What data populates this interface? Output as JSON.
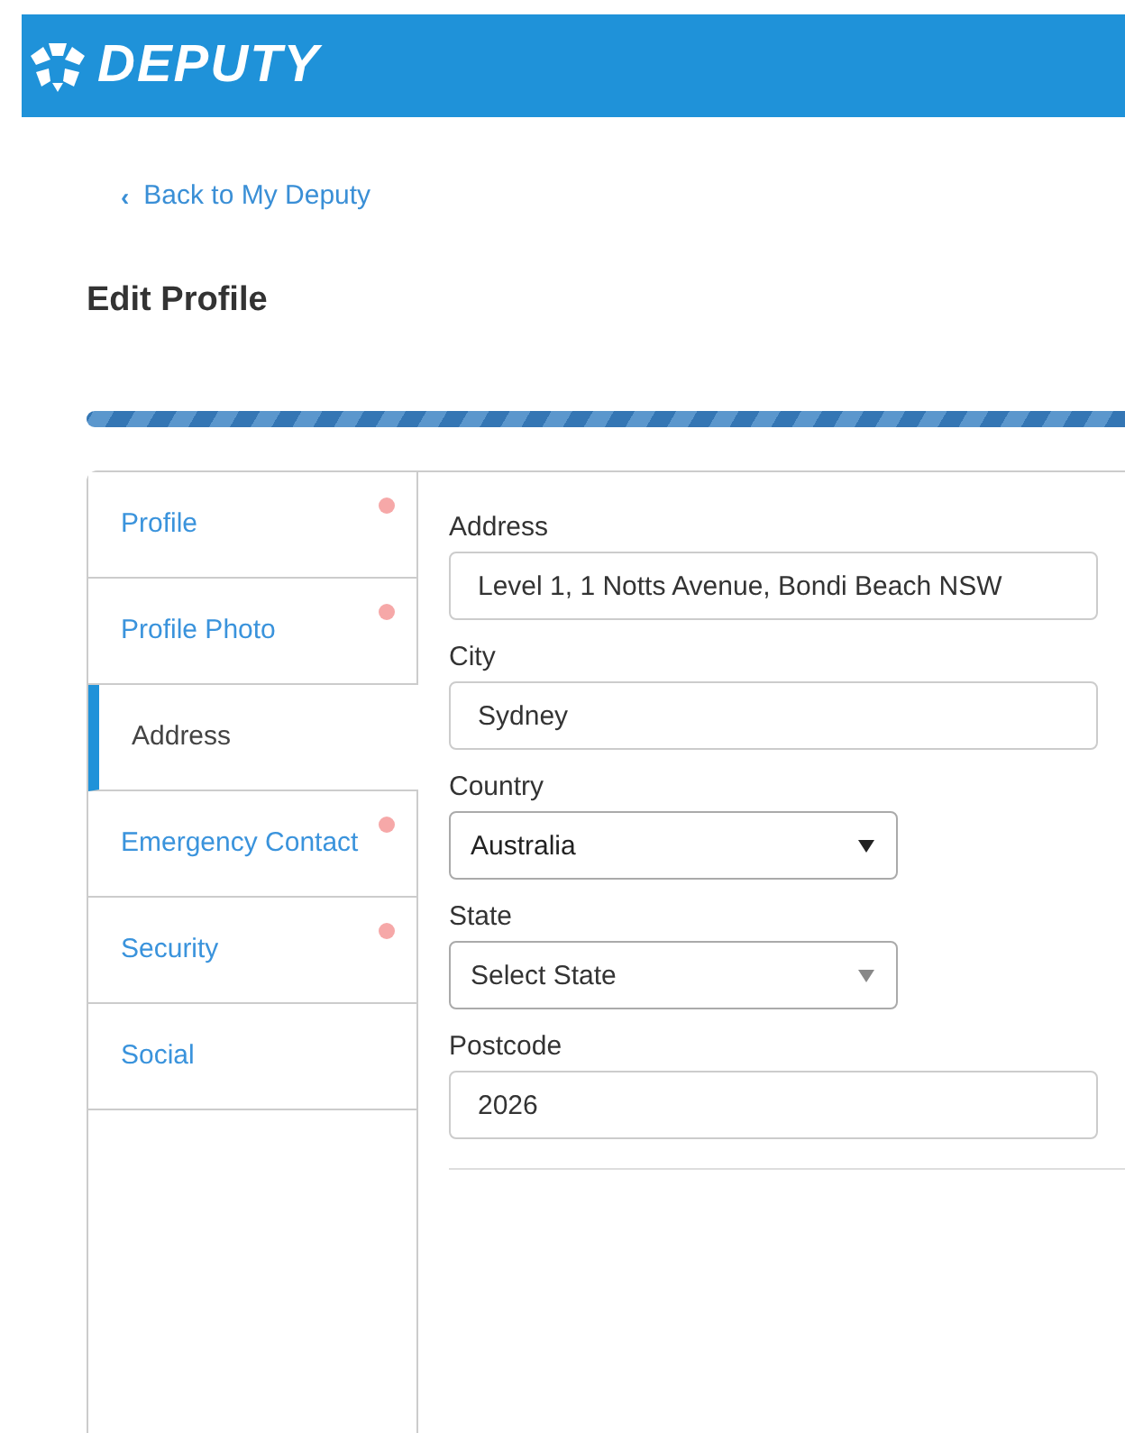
{
  "header": {
    "logo_text": "DEPUTY"
  },
  "back_link": {
    "icon": "‹",
    "label": "Back to My Deputy"
  },
  "title": "Edit Profile",
  "progress": {
    "level": 1
  },
  "tabs": [
    {
      "label": "Profile",
      "selected": false,
      "incomplete": true
    },
    {
      "label": "Profile Photo",
      "selected": false,
      "incomplete": true
    },
    {
      "label": "Address",
      "selected": true,
      "incomplete": false
    },
    {
      "label": "Emergency Contact",
      "selected": false,
      "incomplete": true
    },
    {
      "label": "Security",
      "selected": false,
      "incomplete": true
    },
    {
      "label": "Social",
      "selected": false,
      "incomplete": false
    }
  ],
  "fields": [
    {
      "kind": "text",
      "label": "Address",
      "value": "Level 1, 1 Notts Avenue, Bondi Beach NSW"
    },
    {
      "kind": "text",
      "label": "City",
      "value": "Sydney"
    },
    {
      "kind": "select",
      "label": "Country",
      "value": "Australia"
    },
    {
      "kind": "select",
      "label": "State",
      "placeholder": "Select State"
    },
    {
      "kind": "text",
      "label": "Postcode",
      "value": "2026"
    }
  ]
}
